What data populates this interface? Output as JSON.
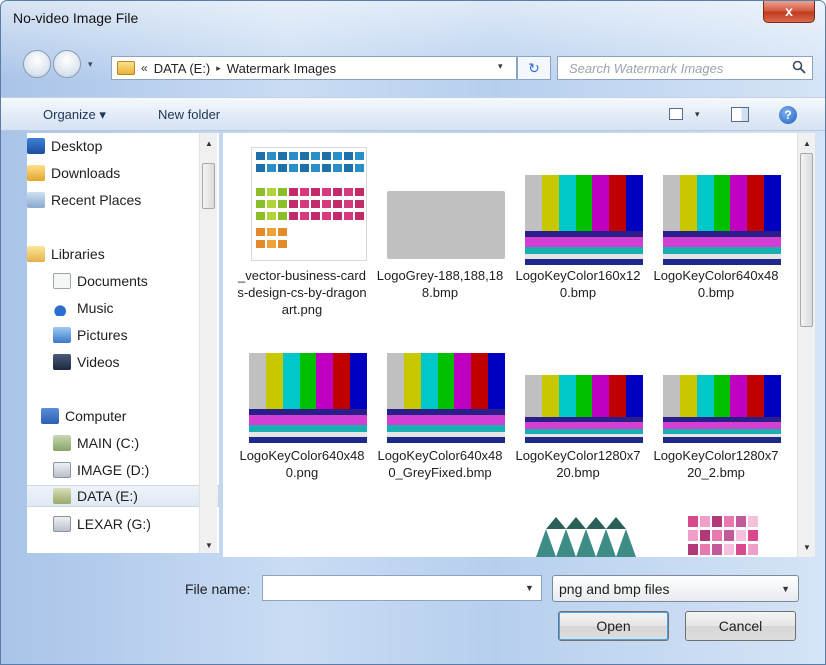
{
  "window": {
    "title": "No-video Image File",
    "close_label": "x"
  },
  "address": {
    "chevrons": "«",
    "crumbs": [
      "DATA (E:)",
      "Watermark Images"
    ],
    "separator": "▸",
    "refresh_glyph": "↻"
  },
  "search": {
    "placeholder": "Search Watermark Images"
  },
  "toolbar": {
    "organize_label": "Organize ▾",
    "new_folder_label": "New folder",
    "help_label": "?"
  },
  "nav": {
    "items": [
      {
        "label": "Desktop",
        "icon": "desktop-icon"
      },
      {
        "label": "Downloads",
        "icon": "downloads-icon"
      },
      {
        "label": "Recent Places",
        "icon": "recent-places-icon"
      },
      {
        "label": "Libraries",
        "icon": "libraries-icon"
      },
      {
        "label": "Documents",
        "icon": "documents-icon"
      },
      {
        "label": "Music",
        "icon": "music-icon"
      },
      {
        "label": "Pictures",
        "icon": "pictures-icon"
      },
      {
        "label": "Videos",
        "icon": "videos-icon"
      },
      {
        "label": "Computer",
        "icon": "computer-icon"
      },
      {
        "label": "MAIN (C:)",
        "icon": "drive-icon"
      },
      {
        "label": "IMAGE (D:)",
        "icon": "drive-icon"
      },
      {
        "label": "DATA (E:)",
        "icon": "drive-icon"
      },
      {
        "label": "LEXAR (G:)",
        "icon": "drive-icon"
      }
    ],
    "selected": "DATA (E:)"
  },
  "files": [
    {
      "name": "_vector-business-cards-design-cs-by-dragonart.png",
      "thumb": "business-cards"
    },
    {
      "name": "LogoGrey-188,188,188.bmp",
      "thumb": "grey"
    },
    {
      "name": "LogoKeyColor160x120.bmp",
      "thumb": "color-bars"
    },
    {
      "name": "LogoKeyColor640x480.bmp",
      "thumb": "color-bars"
    },
    {
      "name": "LogoKeyColor640x480.png",
      "thumb": "color-bars"
    },
    {
      "name": "LogoKeyColor640x480_GreyFixed.bmp",
      "thumb": "color-bars"
    },
    {
      "name": "LogoKeyColor1280x720.bmp",
      "thumb": "color-bars"
    },
    {
      "name": "LogoKeyColor1280x720_2.bmp",
      "thumb": "color-bars"
    }
  ],
  "bottom": {
    "file_name_label": "File name:",
    "file_name_value": "",
    "filter_value": "png and bmp files",
    "open_label": "Open",
    "cancel_label": "Cancel"
  },
  "colors": {
    "bars": [
      "#c0c0c0",
      "#c8c800",
      "#00c8c8",
      "#00c000",
      "#c000c0",
      "#c00000",
      "#0000c0"
    ],
    "selection_border": "#4ba3e8"
  }
}
